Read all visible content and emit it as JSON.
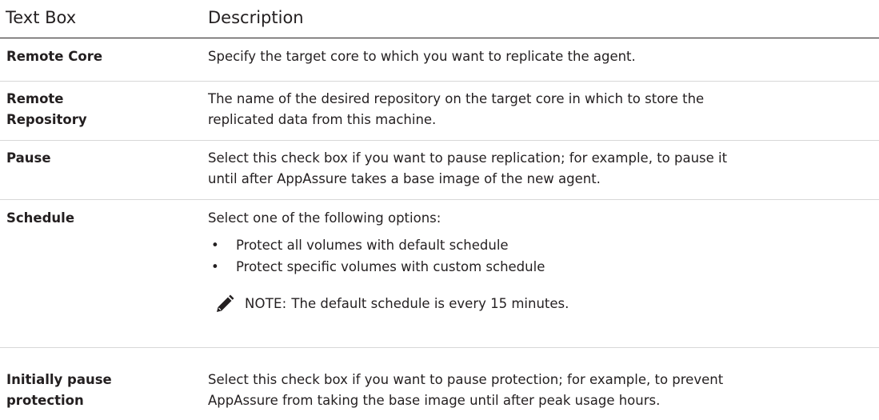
{
  "table": {
    "header": {
      "term": "Text Box",
      "description": "Description"
    },
    "rows": [
      {
        "term_lines": [
          "Remote Core"
        ],
        "description_lines": [
          "Specify the target core to which you want to replicate the agent."
        ]
      },
      {
        "term_lines": [
          "Remote",
          "Repository"
        ],
        "description_lines": [
          "The name of the desired repository on the target core in which to store the",
          "replicated data from this machine."
        ]
      },
      {
        "term_lines": [
          "Pause"
        ],
        "description_lines": [
          "Select this check box if you want to pause replication; for example, to pause it",
          "until after AppAssure takes a base image of the new agent."
        ]
      },
      {
        "term_lines": [
          "Schedule"
        ],
        "description_lines": [
          "Select one of the following options:"
        ],
        "options": [
          "Protect all volumes with default schedule",
          "Protect specific volumes with custom schedule"
        ],
        "bullet": "•",
        "note": {
          "icon": "pen-icon",
          "label": "NOTE:",
          "text": "The default schedule is every 15 minutes."
        }
      },
      {
        "term_lines": [
          "Initially pause",
          "protection"
        ],
        "description_lines": [
          "Select this check box if you want to pause protection; for example, to prevent",
          "AppAssure from taking the base image until after peak usage hours."
        ]
      }
    ]
  },
  "colors": {
    "text": "#231f20",
    "header_rule": "#231f20",
    "row_rule": "#d7d7d7"
  }
}
